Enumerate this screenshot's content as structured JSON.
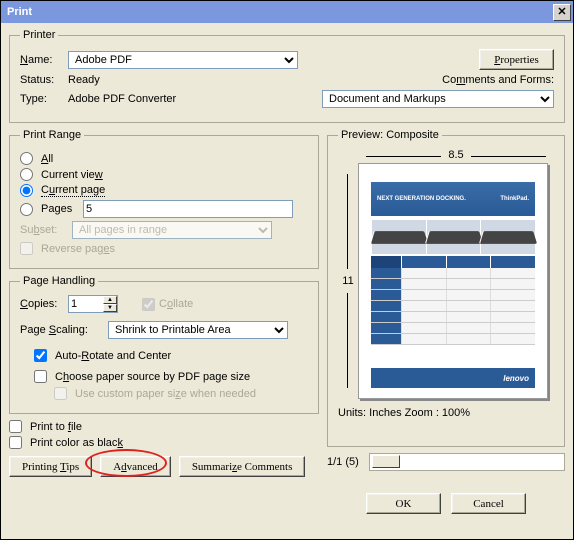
{
  "title": "Print",
  "printer": {
    "legend": "Printer",
    "name_label": "Name:",
    "name_value": "Adobe PDF",
    "properties_btn": "Properties",
    "status_label": "Status:",
    "status_value": "Ready",
    "type_label": "Type:",
    "type_value": "Adobe PDF Converter",
    "comments_label": "Comments and Forms:",
    "comments_value": "Document and Markups"
  },
  "range": {
    "legend": "Print Range",
    "all": "All",
    "current_view": "Current view",
    "current_page": "Current page",
    "pages_label": "Pages",
    "pages_value": "5",
    "subset_label": "Subset:",
    "subset_value": "All pages in range",
    "reverse": "Reverse pages"
  },
  "handling": {
    "legend": "Page Handling",
    "copies_label": "Copies:",
    "copies_value": "1",
    "collate": "Collate",
    "scaling_label": "Page Scaling:",
    "scaling_value": "Shrink to Printable Area",
    "auto_rotate": "Auto-Rotate and Center",
    "choose_source": "Choose paper source by PDF page size",
    "custom_paper": "Use custom paper size when needed"
  },
  "options": {
    "print_to_file": "Print to file",
    "print_black": "Print color as black"
  },
  "buttons": {
    "tips": "Printing Tips",
    "advanced": "Advanced",
    "summarize": "Summarize Comments",
    "ok": "OK",
    "cancel": "Cancel"
  },
  "preview": {
    "legend": "Preview: Composite",
    "width": "8.5",
    "height": "11",
    "units": "Units: Inches Zoom : 100%",
    "page_count": "1/1 (5)",
    "page_title": "NEXT GENERATION DOCKING.",
    "brand_top": "ThinkPad.",
    "brand_bottom": "lenovo"
  }
}
